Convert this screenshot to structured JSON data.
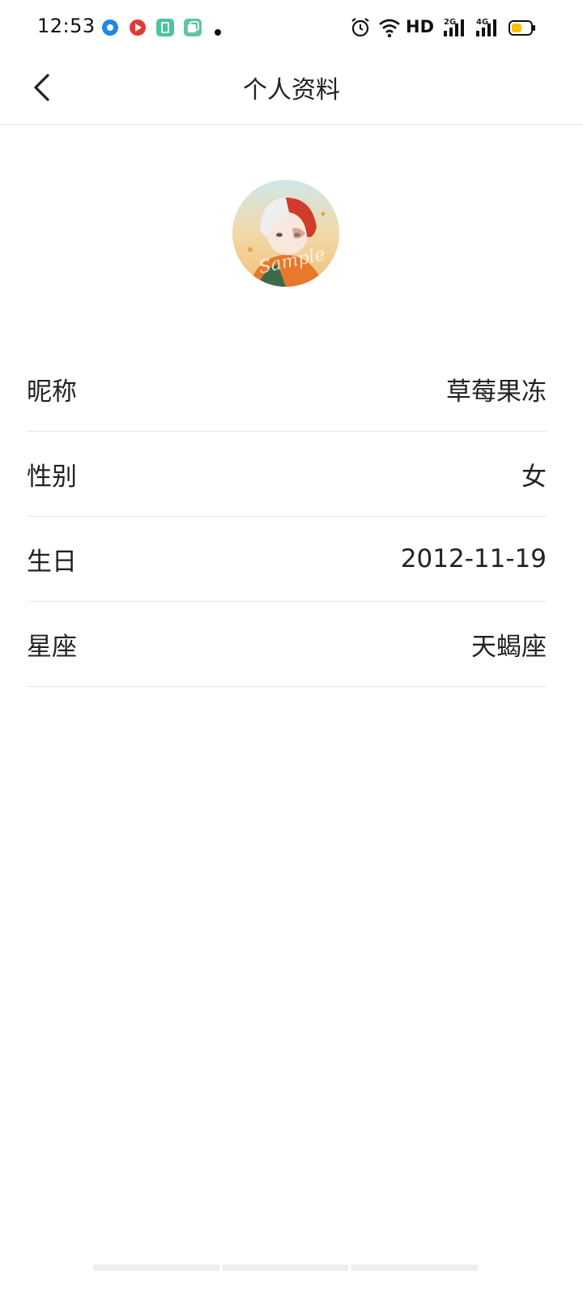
{
  "status_bar": {
    "time": "12:53",
    "network_label": "HD",
    "sig1_label": "2G",
    "sig2_label": "4G",
    "notification_icons": [
      "blue-circle-app-icon",
      "red-video-app-icon",
      "teal-shop-app-icon",
      "green-copy-app-icon",
      "dot-icon"
    ],
    "battery_color": "#f5c400"
  },
  "header": {
    "title": "个人资料",
    "back_icon": "chevron-left-icon"
  },
  "avatar": {
    "watermark": "Sample"
  },
  "profile": {
    "rows": [
      {
        "label": "昵称",
        "value": "草莓果冻"
      },
      {
        "label": "性别",
        "value": "女"
      },
      {
        "label": "生日",
        "value": "2012-11-19"
      },
      {
        "label": "星座",
        "value": "天蝎座"
      }
    ]
  }
}
